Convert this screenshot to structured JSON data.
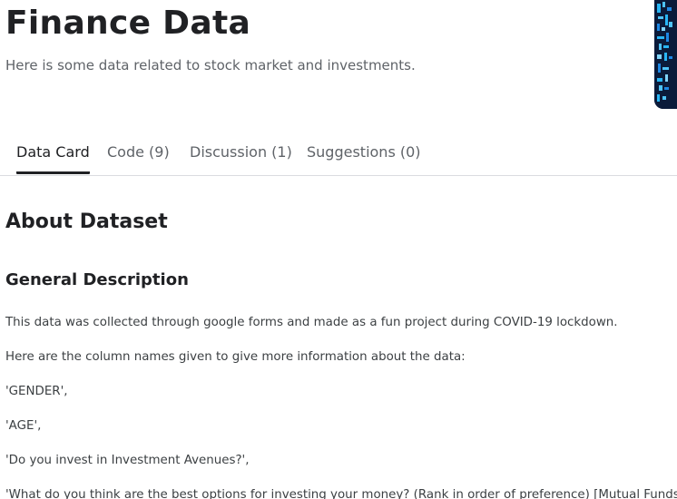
{
  "header": {
    "title": "Finance Data",
    "subtitle": "Here is some data related to stock market and investments."
  },
  "tabs": [
    {
      "label": "Data Card",
      "active": true
    },
    {
      "label": "Code (9)",
      "active": false
    },
    {
      "label": "Discussion (1)",
      "active": false
    },
    {
      "label": "Suggestions (0)",
      "active": false
    }
  ],
  "content": {
    "about_heading": "About Dataset",
    "general_heading": "General Description",
    "paragraphs": [
      "This data was collected through google forms and made as a fun project during COVID-19 lockdown.",
      "Here are the column names given to give more information about the data:",
      "'GENDER',",
      "'AGE',",
      "'Do you invest in Investment Avenues?',",
      "'What do you think are the best options for investing your money? (Rank in order of preference) [Mutual Funds]',"
    ]
  },
  "colors": {
    "text_primary": "#202124",
    "text_secondary": "#5f6368",
    "divider": "#dadce0",
    "cover_bg": "#0b1b3a",
    "cover_accent": "#29b6f6"
  },
  "icons": {
    "cover_image": "dataset-cover-image"
  }
}
